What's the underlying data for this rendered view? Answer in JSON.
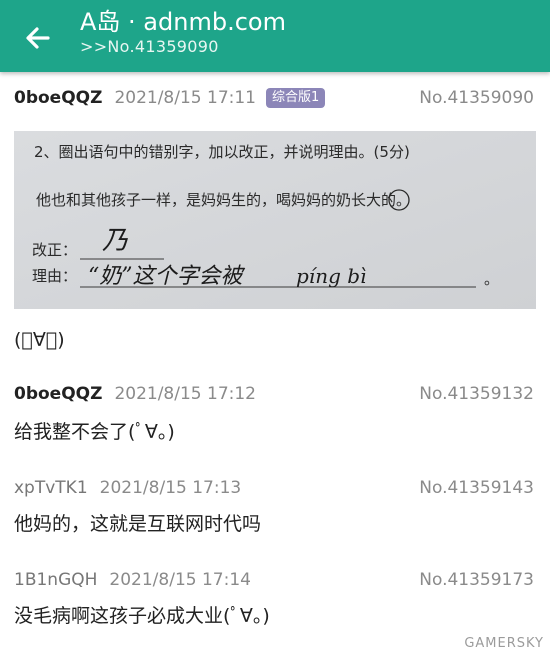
{
  "header": {
    "title": "A岛 · adnmb.com",
    "subtitle": ">>No.41359090",
    "back_icon": "arrow-back-icon",
    "color": "#1ea58a"
  },
  "posts": [
    {
      "uid": "0boeQQZ",
      "uid_bold": true,
      "time": "2021/8/15 17:11",
      "badge": "综合版1",
      "no": "No.41359090",
      "content": "(ﾟ∀。)",
      "image": {
        "lines": [
          "2、圈出语句中的错别字，加以改正，并说明理由。(5分)",
          "他也和其他孩子一样，是妈妈生的，喝妈妈的奶长大的。",
          "改正：",
          "理由："
        ],
        "handwriting": [
          "乃",
          "“奶”这个字会被",
          "píng bì"
        ]
      }
    },
    {
      "uid": "0boeQQZ",
      "uid_bold": true,
      "time": "2021/8/15 17:12",
      "no": "No.41359132",
      "content": "给我整不会了(ﾟ∀。)"
    },
    {
      "uid": "xpTvTK1",
      "uid_bold": false,
      "time": "2021/8/15 17:13",
      "no": "No.41359143",
      "content": "他妈的，这就是互联网时代吗"
    },
    {
      "uid": "1B1nGQH",
      "uid_bold": false,
      "time": "2021/8/15 17:14",
      "no": "No.41359173",
      "content": "没毛病啊这孩子必成大业(ﾟ∀。)"
    }
  ],
  "watermark": "GAMERSKY"
}
